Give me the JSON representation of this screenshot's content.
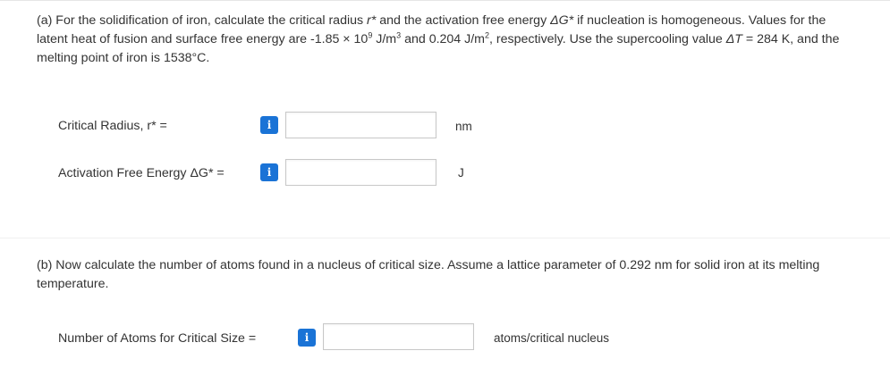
{
  "part_a": {
    "text_prefix": "(a) For the solidification of iron, calculate the critical radius ",
    "r_symbol": "r*",
    "text_mid1": " and the activation free energy ",
    "dg_symbol": "ΔG*",
    "text_mid2": " if nucleation is homogeneous. Values for the latent heat of fusion and surface free energy are -1.85 × 10",
    "exp1": "9",
    "text_mid3": " J/m",
    "exp2": "3",
    "text_mid4": " and 0.204 J/m",
    "exp3": "2",
    "text_mid5": ", respectively. Use the supercooling value ",
    "dt_symbol": "ΔT",
    "text_end": " = 284 K, and the melting point of iron is 1538°C."
  },
  "fields": {
    "critical_radius": {
      "label": "Critical Radius, r* =",
      "info": "i",
      "value": "",
      "unit": "nm"
    },
    "activation_energy": {
      "label": "Activation Free Energy ΔG* =",
      "info": "i",
      "value": "",
      "unit": "J"
    },
    "num_atoms": {
      "label": "Number of Atoms for Critical Size =",
      "info": "i",
      "value": "",
      "unit": "atoms/critical nucleus"
    }
  },
  "part_b": {
    "text": "(b) Now calculate the number of atoms found in a nucleus of critical size. Assume a lattice parameter of 0.292 nm for solid iron at its melting temperature."
  },
  "colors": {
    "info_button": "#1a73d6",
    "text": "#333333",
    "input_border": "#c8c8c8"
  }
}
